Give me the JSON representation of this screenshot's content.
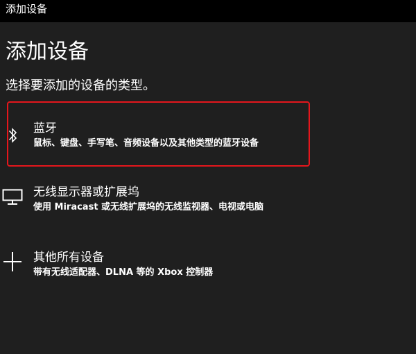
{
  "window": {
    "title": "添加设备"
  },
  "main": {
    "heading": "添加设备",
    "subtitle": "选择要添加的设备的类型。"
  },
  "options": [
    {
      "icon": "bluetooth-icon",
      "title": "蓝牙",
      "description": "鼠标、键盘、手写笔、音频设备以及其他类型的蓝牙设备",
      "highlighted": true
    },
    {
      "icon": "monitor-icon",
      "title": "无线显示器或扩展坞",
      "description": "使用 Miracast 或无线扩展坞的无线监视器、电视或电脑",
      "highlighted": false
    },
    {
      "icon": "plus-icon",
      "title": "其他所有设备",
      "description": "带有无线适配器、DLNA 等的 Xbox 控制器",
      "highlighted": false
    }
  ],
  "colors": {
    "background": "#1f1f1f",
    "titlebar": "#000000",
    "text": "#ffffff",
    "highlight_frame": "#e5161c"
  }
}
